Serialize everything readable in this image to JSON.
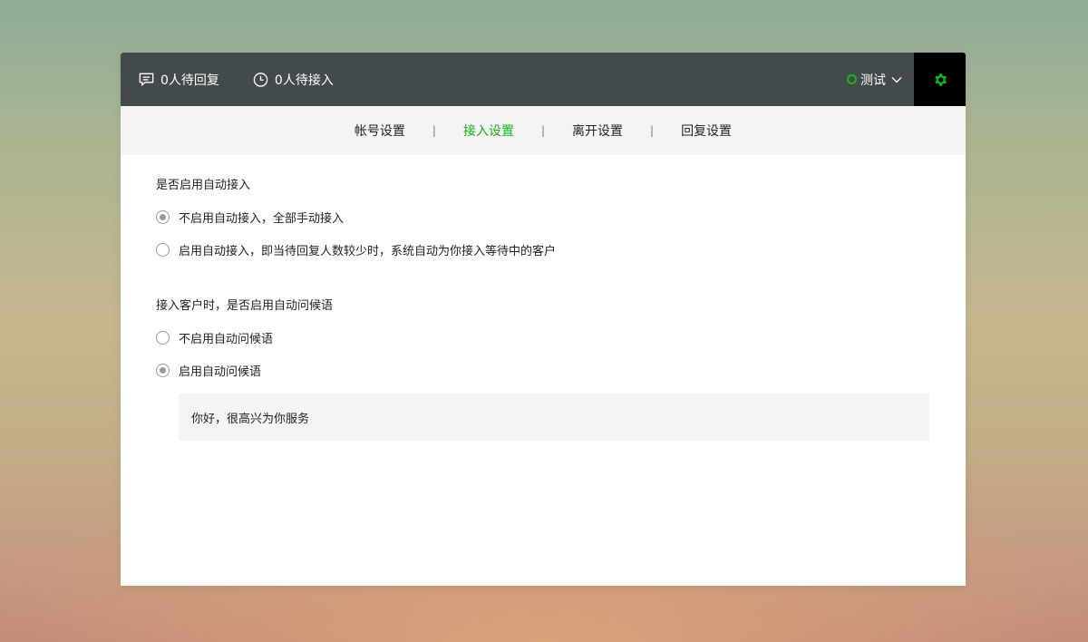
{
  "topbar": {
    "pending_reply": "0人待回复",
    "pending_access": "0人待接入",
    "status_label": "测试",
    "status_color": "#1aad19",
    "icons": [
      "chat-icon",
      "clock-icon",
      "chevron-down-icon",
      "gear-icon"
    ]
  },
  "tabs": [
    {
      "label": "帐号设置",
      "active": false
    },
    {
      "label": "接入设置",
      "active": true
    },
    {
      "label": "离开设置",
      "active": false
    },
    {
      "label": "回复设置",
      "active": false
    }
  ],
  "tab_separator": "|",
  "auto_access": {
    "title": "是否启用自动接入",
    "options": [
      {
        "label": "不启用自动接入，全部手动接入",
        "checked": true
      },
      {
        "label": "启用自动接入，即当待回复人数较少时，系统自动为你接入等待中的客户",
        "checked": false
      }
    ]
  },
  "auto_greeting": {
    "title": "接入客户时，是否启用自动问候语",
    "options": [
      {
        "label": "不启用自动问候语",
        "checked": false
      },
      {
        "label": "启用自动问候语",
        "checked": true
      }
    ],
    "greeting_text": "你好，很高兴为你服务"
  }
}
